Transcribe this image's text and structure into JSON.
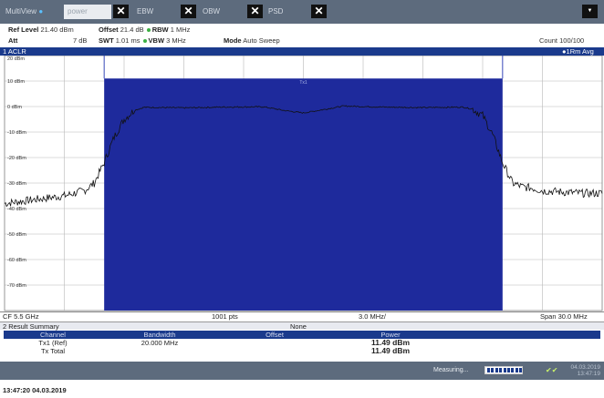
{
  "tabs": {
    "multiview": "MultiView",
    "power_input": "power",
    "items": [
      "EBW",
      "OBW",
      "PSD"
    ]
  },
  "settings": {
    "ref_level_label": "Ref Level",
    "ref_level_value": "21.40 dBm",
    "offset_label": "Offset",
    "offset_value": "21.4 dB",
    "rbw_label": "RBW",
    "rbw_value": "1 MHz",
    "att_label": "Att",
    "att_value": "7 dB",
    "swt_label": "SWT",
    "swt_value": "1.01 ms",
    "vbw_label": "VBW",
    "vbw_value": "3 MHz",
    "mode_label": "Mode",
    "mode_value": "Auto Sweep",
    "count": "Count 100/100"
  },
  "diagram": {
    "title": "1 ACLR",
    "trace_label": "1Rm Avg",
    "channel_label": "Tx1"
  },
  "chart_data": {
    "type": "line",
    "y_tick_labels": [
      "20 dBm",
      "10 dBm",
      "0 dBm",
      "-10 dBm",
      "-20 dBm",
      "-30 dBm",
      "-40 dBm",
      "-50 dBm",
      "-60 dBm",
      "-70 dBm"
    ],
    "ylim": [
      -80,
      20
    ],
    "x_unit": "MHz offset from center",
    "xlim": [
      -15,
      15
    ],
    "channel_band": [
      -10,
      10
    ],
    "channel_top_level": 11,
    "series": [
      {
        "x": [
          -15,
          -14,
          -13,
          -12,
          -11.5,
          -11,
          -10.5,
          -10,
          -9.5,
          -9,
          -8.5,
          -8,
          -6,
          -4,
          -2,
          -1,
          0,
          1,
          2,
          4,
          6,
          8,
          8.5,
          9,
          9.5,
          10,
          10.5,
          11,
          11.5,
          12,
          13,
          14,
          15
        ],
        "values": [
          -38,
          -37,
          -36,
          -35,
          -34,
          -33,
          -30,
          -22,
          -12,
          -5,
          -1.5,
          -0.3,
          -0.5,
          -0.2,
          -0.1,
          -1.5,
          -2.5,
          -1.2,
          0.2,
          -0.2,
          -0.4,
          -0.2,
          -1,
          -3.5,
          -11,
          -22,
          -30,
          -31.5,
          -32,
          -33,
          -33.5,
          -34,
          -34
        ]
      }
    ],
    "footer": {
      "cf": "CF 5.5 GHz",
      "pts": "1001 pts",
      "div": "3.0 MHz/",
      "span": "Span 30.0 MHz"
    }
  },
  "result_summary": {
    "title": "2 Result Summary",
    "mode": "None",
    "headers": [
      "Channel",
      "Bandwidth",
      "Offset",
      "Power"
    ],
    "rows": [
      [
        "Tx1 (Ref)",
        "20.000 MHz",
        "",
        "11.49 dBm"
      ],
      [
        "Tx Total",
        "",
        "",
        "11.49 dBm"
      ]
    ]
  },
  "status": {
    "measuring": "Measuring...",
    "date": "04.03.2019",
    "time": "13:47:19"
  },
  "timestamp": "13:47:20  04.03.2019",
  "colors": {
    "header_blue": "#1a3a8c",
    "channel_fill": "#1e2a9c",
    "toolbar": "#5d6b7d"
  }
}
